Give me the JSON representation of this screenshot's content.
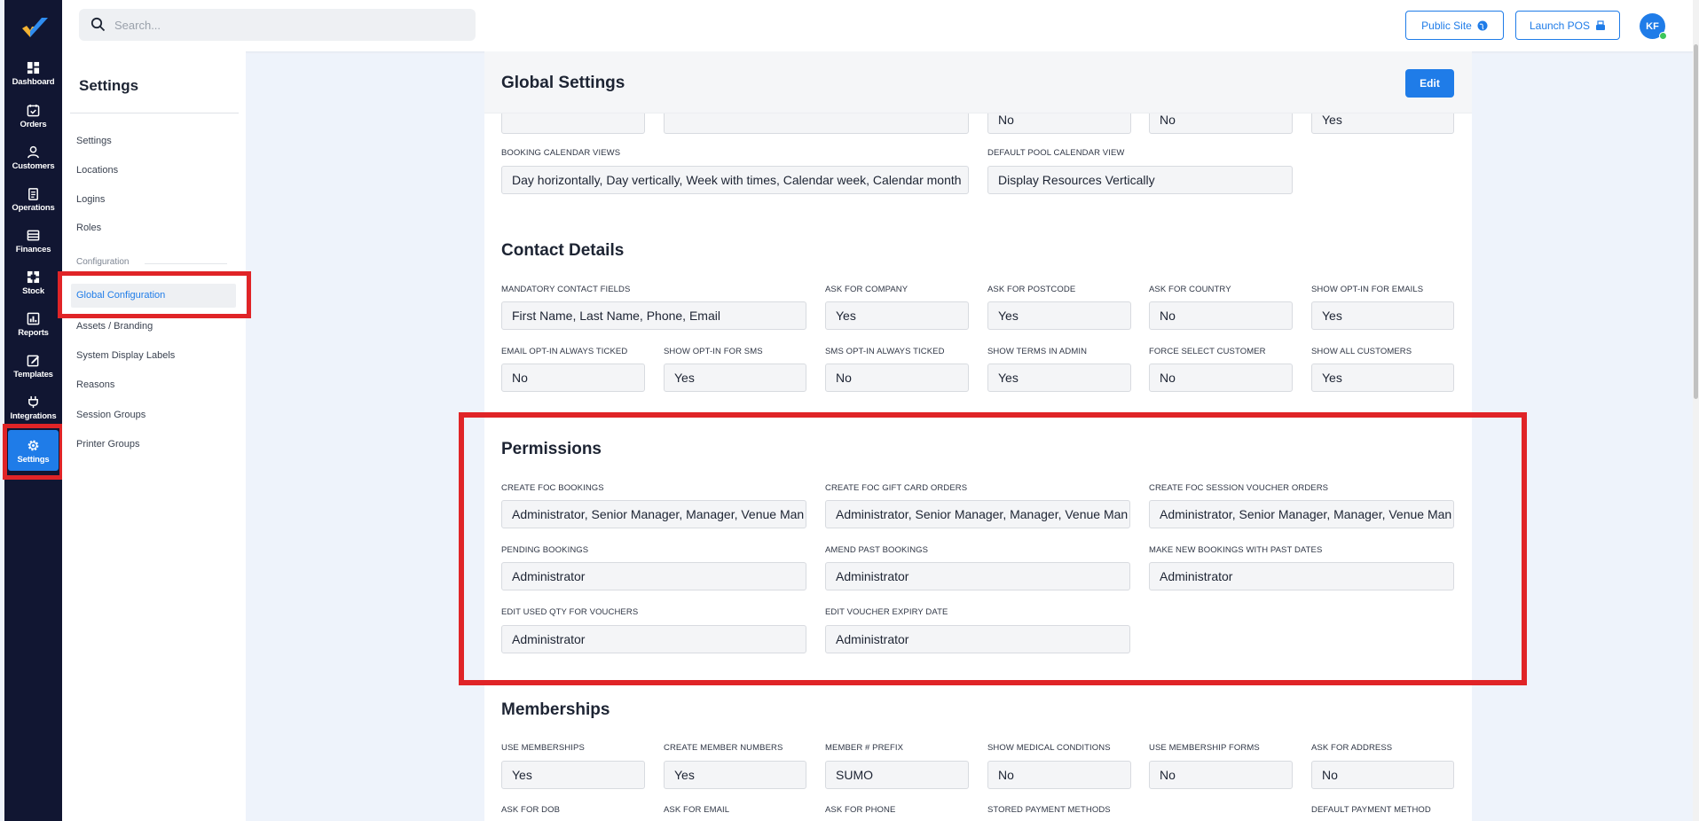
{
  "topbar": {
    "search_placeholder": "Search...",
    "public_site_label": "Public Site",
    "launch_pos_label": "Launch POS",
    "avatar_initials": "KF"
  },
  "rail": {
    "items": [
      {
        "label": "Dashboard",
        "icon": "dashboard-icon"
      },
      {
        "label": "Orders",
        "icon": "calendar-check-icon"
      },
      {
        "label": "Customers",
        "icon": "user-icon"
      },
      {
        "label": "Operations",
        "icon": "clipboard-icon"
      },
      {
        "label": "Finances",
        "icon": "finance-icon"
      },
      {
        "label": "Stock",
        "icon": "stock-icon"
      },
      {
        "label": "Reports",
        "icon": "reports-icon"
      },
      {
        "label": "Templates",
        "icon": "templates-icon"
      },
      {
        "label": "Integrations",
        "icon": "plug-icon"
      },
      {
        "label": "Settings",
        "icon": "gear-icon"
      }
    ]
  },
  "subnav": {
    "title": "Settings",
    "items": [
      "Settings",
      "Locations",
      "Logins",
      "Roles"
    ],
    "section_label": "Configuration",
    "active_item": "Global Configuration",
    "config_items": [
      "Assets / Branding",
      "System Display Labels",
      "Reasons",
      "Session Groups",
      "Printer Groups"
    ]
  },
  "page": {
    "title": "Global Settings",
    "edit_label": "Edit"
  },
  "top_partial_row": {
    "values": [
      "",
      "",
      "No",
      "No",
      "Yes"
    ]
  },
  "calendar": {
    "booking_calendar_views_label": "BOOKING CALENDAR VIEWS",
    "booking_calendar_views_value": "Day horizontally, Day vertically, Week with times, Calendar week, Calendar month",
    "default_pool_label": "DEFAULT POOL CALENDAR VIEW",
    "default_pool_value": "Display Resources Vertically"
  },
  "contact": {
    "title": "Contact Details",
    "row1": [
      {
        "label": "MANDATORY CONTACT FIELDS",
        "value": "First Name, Last Name, Phone, Email"
      },
      {
        "label": "ASK FOR COMPANY",
        "value": "Yes"
      },
      {
        "label": "ASK FOR POSTCODE",
        "value": "Yes"
      },
      {
        "label": "ASK FOR COUNTRY",
        "value": "No"
      },
      {
        "label": "SHOW OPT-IN FOR EMAILS",
        "value": "Yes"
      }
    ],
    "row2": [
      {
        "label": "EMAIL OPT-IN ALWAYS TICKED",
        "value": "No"
      },
      {
        "label": "SHOW OPT-IN FOR SMS",
        "value": "Yes"
      },
      {
        "label": "SMS OPT-IN ALWAYS TICKED",
        "value": "No"
      },
      {
        "label": "SHOW TERMS IN ADMIN",
        "value": "Yes"
      },
      {
        "label": "FORCE SELECT CUSTOMER",
        "value": "No"
      },
      {
        "label": "SHOW ALL CUSTOMERS",
        "value": "Yes"
      }
    ]
  },
  "permissions": {
    "title": "Permissions",
    "row1": [
      {
        "label": "CREATE FOC BOOKINGS",
        "value": "Administrator, Senior Manager, Manager, Venue Man"
      },
      {
        "label": "CREATE FOC GIFT CARD ORDERS",
        "value": "Administrator, Senior Manager, Manager, Venue Man"
      },
      {
        "label": "CREATE FOC SESSION VOUCHER ORDERS",
        "value": "Administrator, Senior Manager, Manager, Venue Man"
      }
    ],
    "row2": [
      {
        "label": "PENDING BOOKINGS",
        "value": "Administrator"
      },
      {
        "label": "AMEND PAST BOOKINGS",
        "value": "Administrator"
      },
      {
        "label": "MAKE NEW BOOKINGS WITH PAST DATES",
        "value": "Administrator"
      }
    ],
    "row3": [
      {
        "label": "EDIT USED QTY FOR VOUCHERS",
        "value": "Administrator"
      },
      {
        "label": "EDIT VOUCHER EXPIRY DATE",
        "value": "Administrator"
      }
    ]
  },
  "memberships": {
    "title": "Memberships",
    "row1": [
      {
        "label": "USE MEMBERSHIPS",
        "value": "Yes"
      },
      {
        "label": "CREATE MEMBER NUMBERS",
        "value": "Yes"
      },
      {
        "label": "MEMBER # PREFIX",
        "value": "SUMO"
      },
      {
        "label": "SHOW MEDICAL CONDITIONS",
        "value": "No"
      },
      {
        "label": "USE MEMBERSHIP FORMS",
        "value": "No"
      },
      {
        "label": "ASK FOR ADDRESS",
        "value": "No"
      }
    ],
    "row2_labels": [
      "ASK FOR DOB",
      "ASK FOR EMAIL",
      "ASK FOR PHONE",
      "STORED PAYMENT METHODS",
      "DEFAULT PAYMENT METHOD"
    ]
  },
  "colors": {
    "accent": "#1f7ce8",
    "rail_bg": "#111632",
    "highlight": "#e02427"
  }
}
